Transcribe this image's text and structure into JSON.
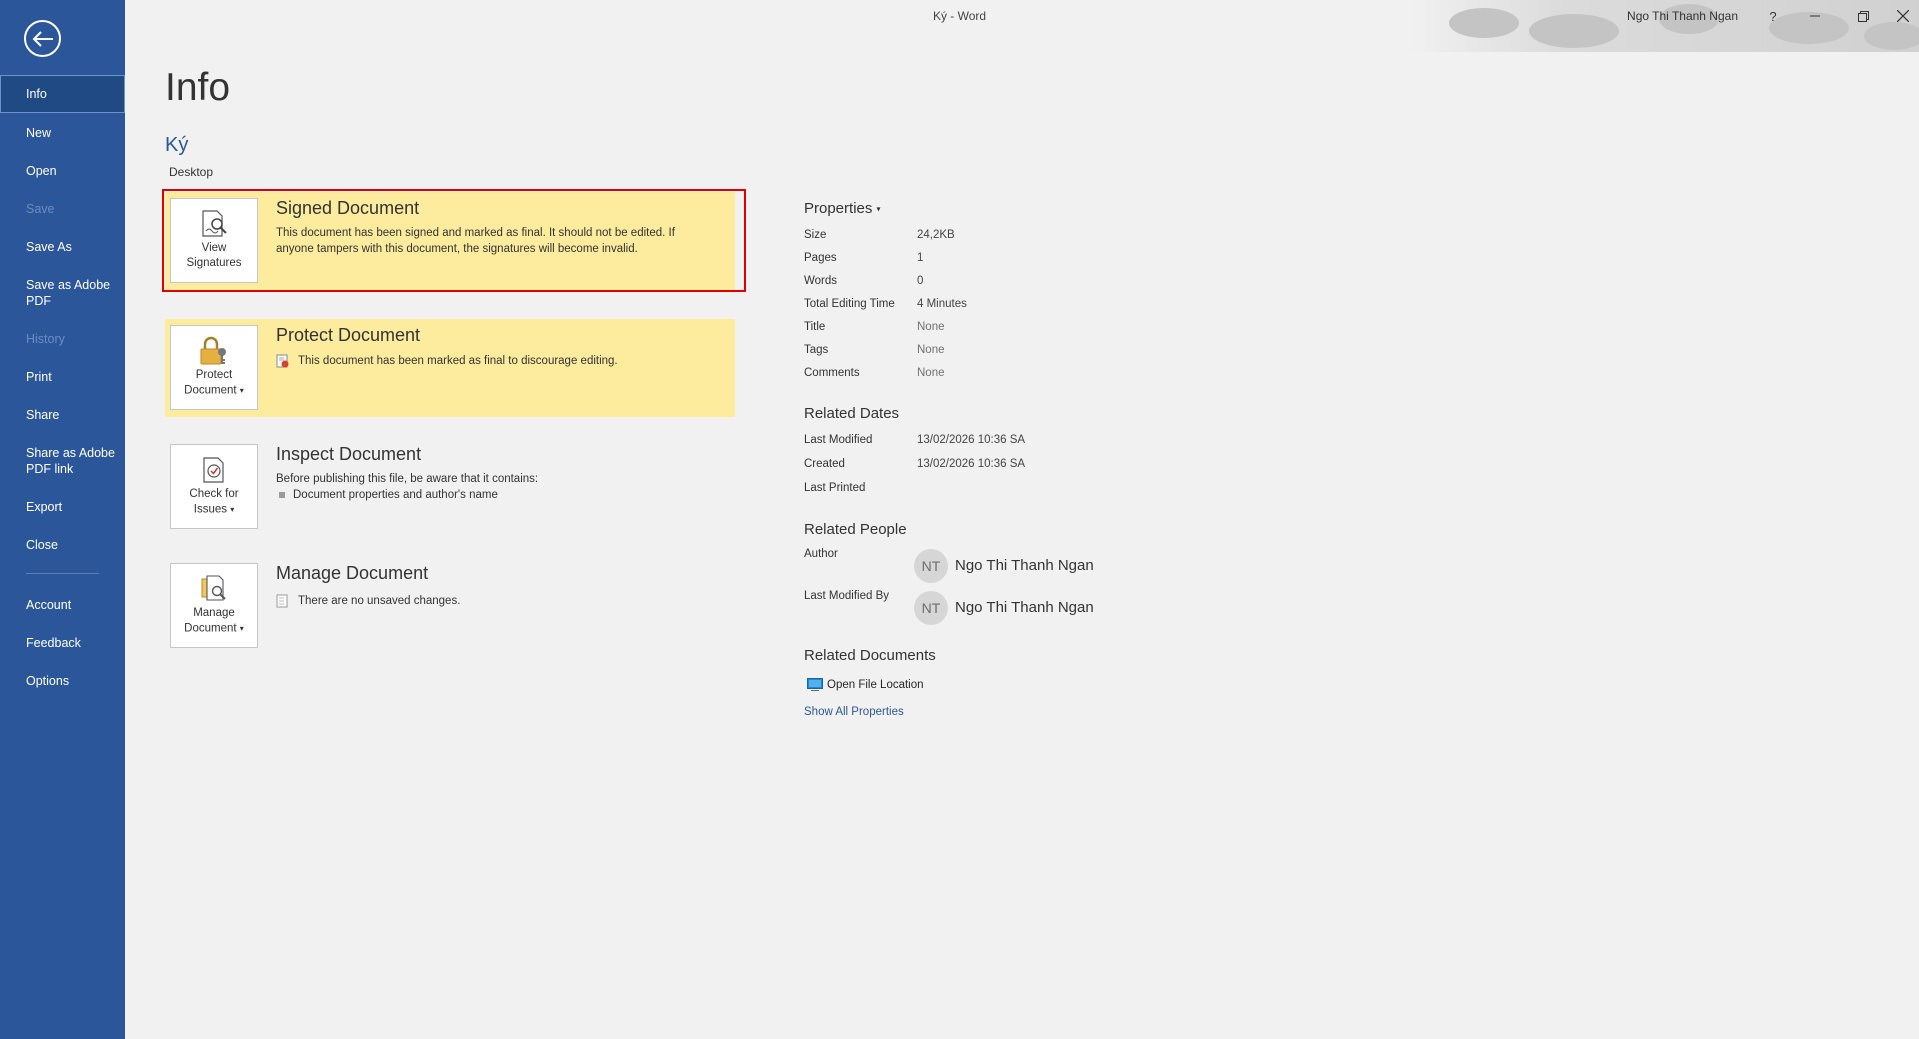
{
  "window": {
    "title": "Ký  -  Word",
    "user": "Ngo Thi Thanh Ngan",
    "help": "?"
  },
  "nav": {
    "items": [
      {
        "label": "Info",
        "state": "active"
      },
      {
        "label": "New",
        "state": "normal"
      },
      {
        "label": "Open",
        "state": "normal"
      },
      {
        "label": "Save",
        "state": "disabled"
      },
      {
        "label": "Save As",
        "state": "normal"
      },
      {
        "label": "Save as Adobe PDF",
        "state": "normal"
      },
      {
        "label": "History",
        "state": "disabled"
      },
      {
        "label": "Print",
        "state": "normal"
      },
      {
        "label": "Share",
        "state": "normal"
      },
      {
        "label": "Share as Adobe PDF link",
        "state": "normal"
      },
      {
        "label": "Export",
        "state": "normal"
      },
      {
        "label": "Close",
        "state": "normal"
      },
      {
        "label": "Account",
        "state": "normal"
      },
      {
        "label": "Feedback",
        "state": "normal"
      },
      {
        "label": "Options",
        "state": "normal"
      }
    ]
  },
  "page": {
    "title": "Info",
    "doc_name": "Ký",
    "doc_location": "Desktop"
  },
  "sections": {
    "signed": {
      "button": "View Signatures",
      "title": "Signed Document",
      "desc": "This document has been signed and marked as final. It should not be edited.  If anyone tampers with this document, the signatures will become invalid."
    },
    "protect": {
      "button_line1": "Protect",
      "button_line2": "Document",
      "title": "Protect Document",
      "desc": "This document has been marked as final to discourage editing."
    },
    "inspect": {
      "button_line1": "Check for",
      "button_line2": "Issues",
      "title": "Inspect Document",
      "desc": "Before publishing this file, be aware that it contains:",
      "bullet": "Document properties and author's name"
    },
    "manage": {
      "button_line1": "Manage",
      "button_line2": "Document",
      "title": "Manage Document",
      "desc": "There are no unsaved changes."
    }
  },
  "properties": {
    "heading": "Properties",
    "rows": [
      {
        "key": "Size",
        "value": "24,2KB"
      },
      {
        "key": "Pages",
        "value": "1"
      },
      {
        "key": "Words",
        "value": "0"
      },
      {
        "key": "Total Editing Time",
        "value": "4 Minutes"
      },
      {
        "key": "Title",
        "value": "None"
      },
      {
        "key": "Tags",
        "value": "None"
      },
      {
        "key": "Comments",
        "value": "None"
      }
    ]
  },
  "related_dates": {
    "heading": "Related Dates",
    "rows": [
      {
        "key": "Last Modified",
        "value": "13/02/2026 10:36 SA"
      },
      {
        "key": "Created",
        "value": "13/02/2026 10:36 SA"
      },
      {
        "key": "Last Printed",
        "value": ""
      }
    ]
  },
  "related_people": {
    "heading": "Related People",
    "author_label": "Author",
    "author_initials": "NT",
    "author_name": "Ngo Thi Thanh Ngan",
    "modified_label": "Last Modified By",
    "modified_initials": "NT",
    "modified_name": "Ngo Thi Thanh Ngan"
  },
  "related_documents": {
    "heading": "Related Documents",
    "open_location": "Open File Location",
    "show_all": "Show All Properties"
  },
  "colors": {
    "nav": "#2b579a",
    "highlight": "#fdeb9e",
    "frame": "#e00000"
  }
}
